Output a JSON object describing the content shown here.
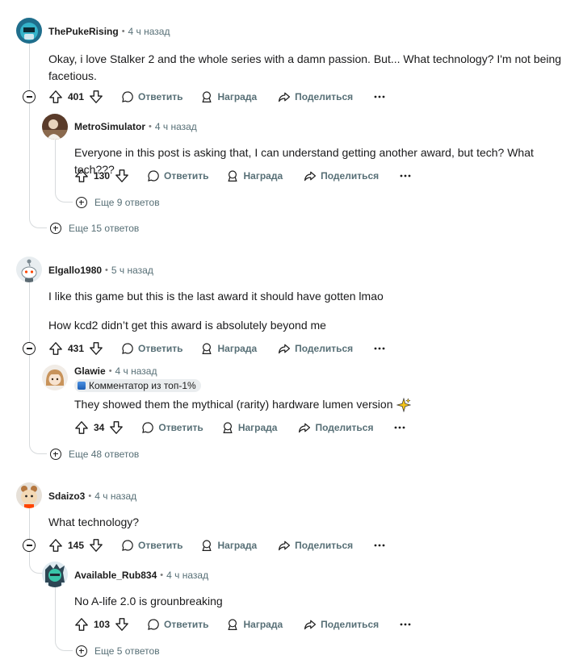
{
  "comments": [
    {
      "author": "ThePukeRising",
      "time": "4 ч назад",
      "body": [
        "Okay, i love Stalker 2 and the whole series with a damn passion. But... What technology? I'm not being",
        "facetious."
      ],
      "votes": "401",
      "reply_label": "Ответить",
      "award_label": "Награда",
      "share_label": "Поделиться",
      "more_replies": "Еще 15 ответов",
      "replies": [
        {
          "author": "MetroSimulator",
          "time": "4 ч назад",
          "body": "Everyone in this post is asking that, I can understand getting another award, but tech? What tech???",
          "votes": "130",
          "reply_label": "Ответить",
          "award_label": "Награда",
          "share_label": "Поделиться",
          "more_replies": "Еще 9 ответов"
        }
      ]
    },
    {
      "author": "Elgallo1980",
      "time": "5 ч назад",
      "body": [
        "I like this game but this is the last award it should have gotten lmao",
        "How kcd2 didn’t get this award is absolutely beyond me"
      ],
      "votes": "431",
      "reply_label": "Ответить",
      "award_label": "Награда",
      "share_label": "Поделиться",
      "more_replies": "Еще 48 ответов",
      "replies": [
        {
          "author": "Glawie",
          "time": "4 ч назад",
          "badge": "Комментатор из топ-1%",
          "body": "They showed them the mythical (rarity) hardware lumen version",
          "votes": "34",
          "reply_label": "Ответить",
          "award_label": "Награда",
          "share_label": "Поделиться"
        }
      ]
    },
    {
      "author": "Sdaizo3",
      "time": "4 ч назад",
      "body": [
        "What technology?"
      ],
      "votes": "145",
      "reply_label": "Ответить",
      "award_label": "Награда",
      "share_label": "Поделиться",
      "replies": [
        {
          "author": "Available_Rub834",
          "time": "4 ч назад",
          "body": "No A-life 2.0 is grounbreaking",
          "votes": "103",
          "reply_label": "Ответить",
          "award_label": "Награда",
          "share_label": "Поделиться",
          "more_replies": "Еще 5 ответов"
        }
      ]
    }
  ],
  "colors": {
    "text": "#1a1a1b",
    "muted": "#576f76",
    "line": "#d7dadc"
  }
}
